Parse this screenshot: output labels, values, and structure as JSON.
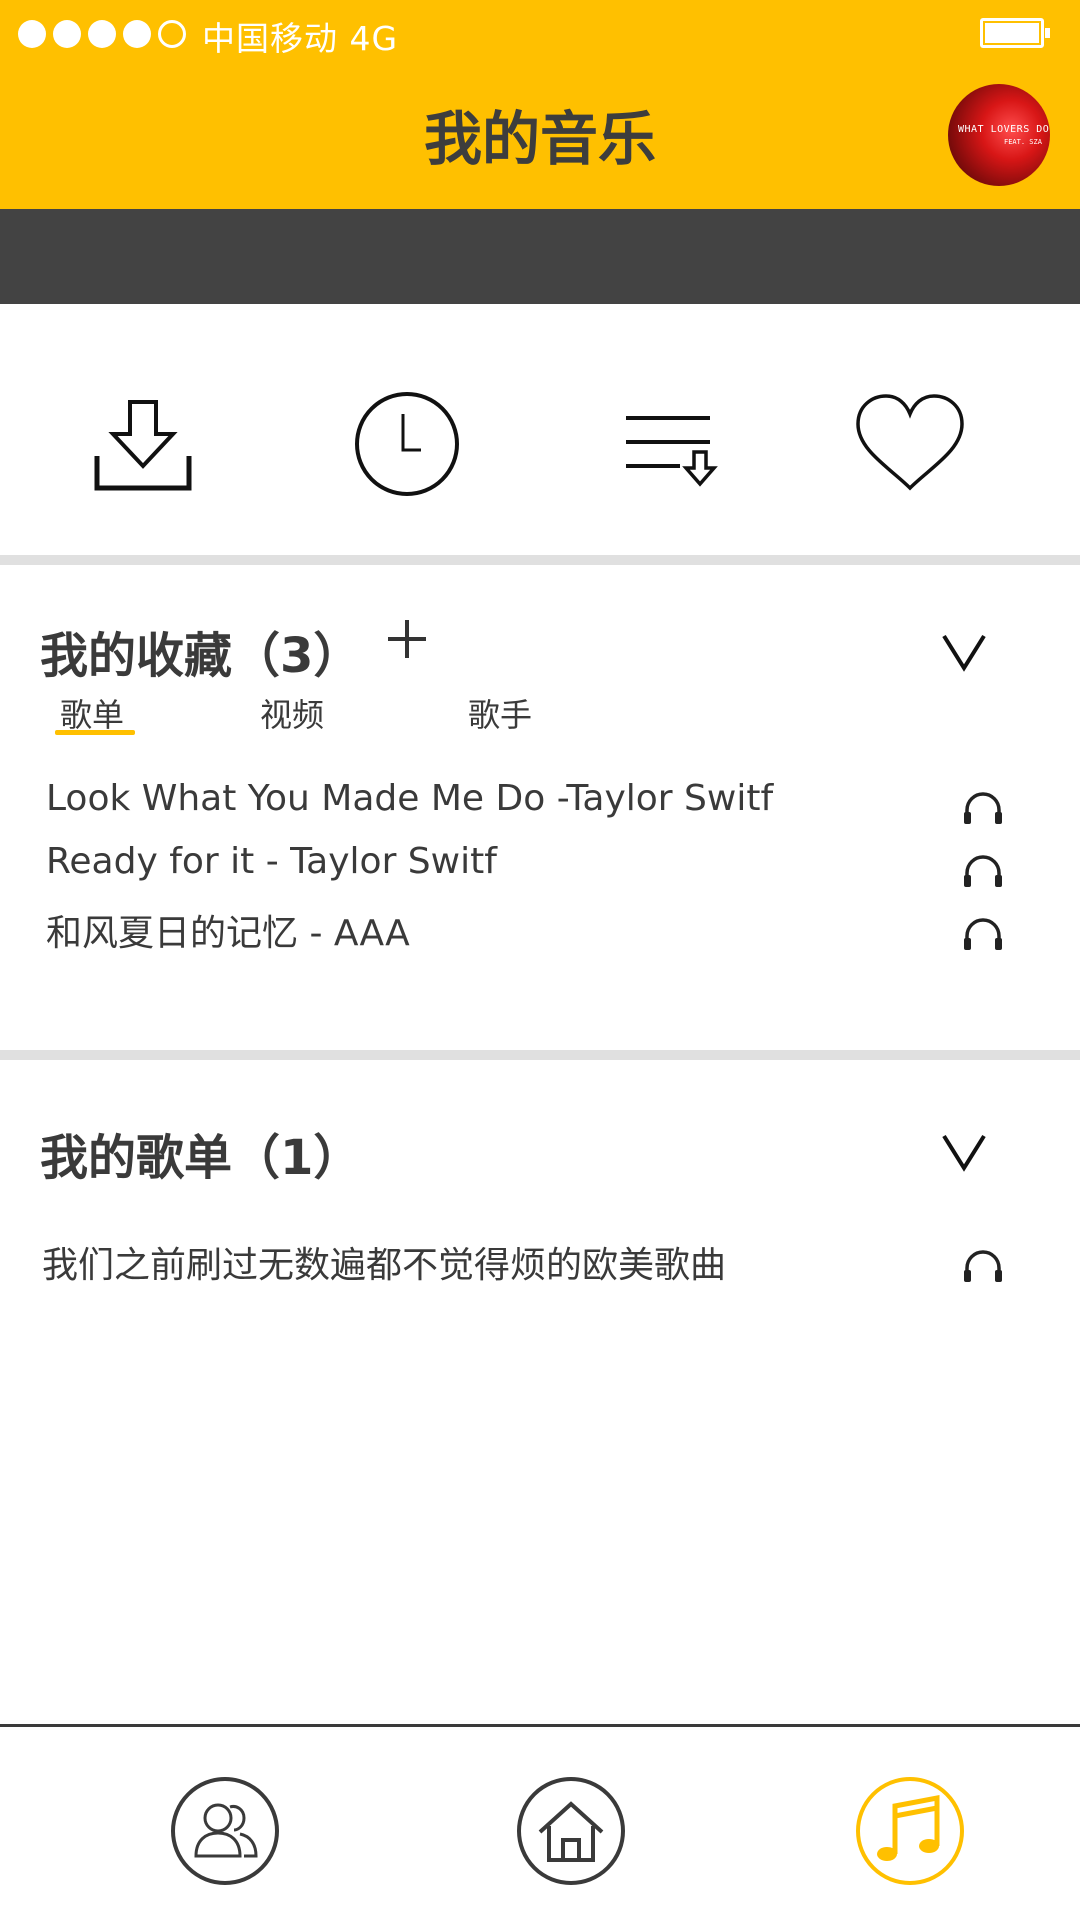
{
  "status_bar": {
    "carrier": "中国移动  4G",
    "signal_filled": 4,
    "signal_total": 5,
    "battery_level": 1.0
  },
  "header": {
    "title": "我的音乐",
    "album_art": {
      "text_line1": "WHAT LOVERS DO",
      "text_line2": "FEAT. SZA"
    }
  },
  "quick_actions": [
    {
      "icon": "download-icon"
    },
    {
      "icon": "clock-icon"
    },
    {
      "icon": "playlist-download-icon"
    },
    {
      "icon": "heart-icon"
    }
  ],
  "favorites": {
    "title": "我的收藏（3）",
    "add_symbol": "+",
    "tabs": [
      "歌单",
      "视频",
      "歌手"
    ],
    "active_tab": 0,
    "songs": [
      "Look What You Made  Me Do -Taylor Switf",
      "Ready for it - Taylor Switf",
      "和风夏日的记忆   -   AAA"
    ]
  },
  "playlists": {
    "title": "我的歌单（1）",
    "items": [
      "我们之前刷过无数遍都不觉得烦的欧美歌曲"
    ]
  },
  "bottom_nav": [
    {
      "icon": "friends-icon",
      "active": false
    },
    {
      "icon": "home-icon",
      "active": false
    },
    {
      "icon": "music-note-icon",
      "active": true
    }
  ],
  "colors": {
    "accent": "#FFC000",
    "dark_band": "#434343",
    "text": "#3a3a3a",
    "divider": "#e0e0e0"
  }
}
